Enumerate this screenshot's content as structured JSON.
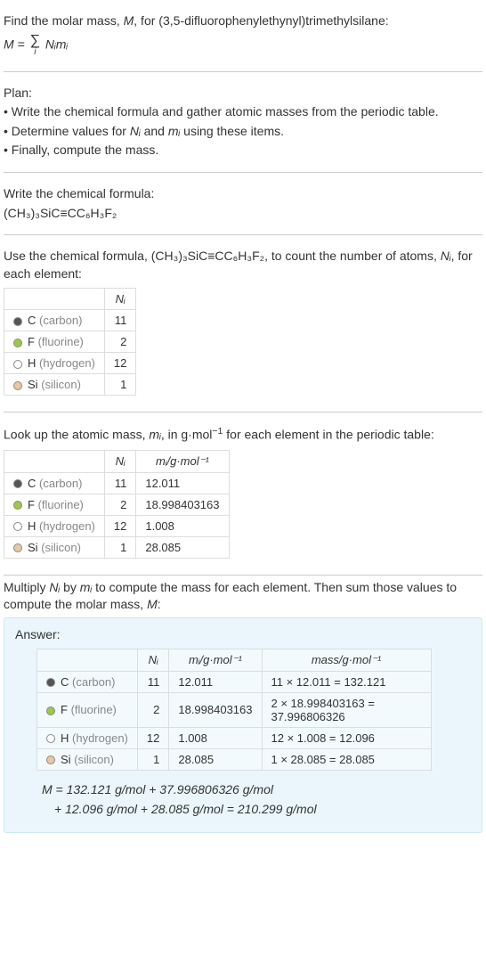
{
  "intro": {
    "line1_pre": "Find the molar mass, ",
    "line1_m": "M",
    "line1_post": ", for (3,5-difluorophenylethynyl)trimethylsilane:",
    "formula_lhs": "M = ",
    "formula_rhs": " Nᵢmᵢ",
    "sigma_sub": "i"
  },
  "plan": {
    "title": "Plan:",
    "b1": "• Write the chemical formula and gather atomic masses from the periodic table.",
    "b2_pre": "• Determine values for ",
    "b2_ni": "Nᵢ",
    "b2_mid": " and ",
    "b2_mi": "mᵢ",
    "b2_post": " using these items.",
    "b3": "• Finally, compute the mass."
  },
  "chem": {
    "title": "Write the chemical formula:",
    "formula": "(CH₃)₃SiC≡CC₆H₃F₂"
  },
  "count": {
    "line_pre": "Use the chemical formula, (CH₃)₃SiC≡CC₆H₃F₂, to count the number of atoms, ",
    "ni": "Nᵢ",
    "line_post": ", for each element:"
  },
  "table1": {
    "h_ni": "Nᵢ",
    "rows": [
      {
        "dot": "dot-c",
        "sym": "C",
        "name": "(carbon)",
        "ni": "11"
      },
      {
        "dot": "dot-f",
        "sym": "F",
        "name": "(fluorine)",
        "ni": "2"
      },
      {
        "dot": "dot-h",
        "sym": "H",
        "name": "(hydrogen)",
        "ni": "12"
      },
      {
        "dot": "dot-si",
        "sym": "Si",
        "name": "(silicon)",
        "ni": "1"
      }
    ]
  },
  "lookup": {
    "line_pre": "Look up the atomic mass, ",
    "mi": "mᵢ",
    "line_mid": ", in g·mol",
    "exp": "−1",
    "line_post": " for each element in the periodic table:"
  },
  "table2": {
    "h_ni": "Nᵢ",
    "h_mi": "mᵢ/g·mol⁻¹",
    "rows": [
      {
        "dot": "dot-c",
        "sym": "C",
        "name": "(carbon)",
        "ni": "11",
        "mi": "12.011"
      },
      {
        "dot": "dot-f",
        "sym": "F",
        "name": "(fluorine)",
        "ni": "2",
        "mi": "18.998403163"
      },
      {
        "dot": "dot-h",
        "sym": "H",
        "name": "(hydrogen)",
        "ni": "12",
        "mi": "1.008"
      },
      {
        "dot": "dot-si",
        "sym": "Si",
        "name": "(silicon)",
        "ni": "1",
        "mi": "28.085"
      }
    ]
  },
  "multiply": {
    "text_pre": "Multiply ",
    "ni": "Nᵢ",
    "text_mid1": " by ",
    "mi": "mᵢ",
    "text_mid2": " to compute the mass for each element. Then sum those values to compute the molar mass, ",
    "m": "M",
    "text_post": ":"
  },
  "answer": {
    "label": "Answer:",
    "h_ni": "Nᵢ",
    "h_mi": "mᵢ/g·mol⁻¹",
    "h_mass": "mass/g·mol⁻¹",
    "rows": [
      {
        "dot": "dot-c",
        "sym": "C",
        "name": "(carbon)",
        "ni": "11",
        "mi": "12.011",
        "mass": "11 × 12.011 = 132.121"
      },
      {
        "dot": "dot-f",
        "sym": "F",
        "name": "(fluorine)",
        "ni": "2",
        "mi": "18.998403163",
        "mass": "2 × 18.998403163 = 37.996806326"
      },
      {
        "dot": "dot-h",
        "sym": "H",
        "name": "(hydrogen)",
        "ni": "12",
        "mi": "1.008",
        "mass": "12 × 1.008 = 12.096"
      },
      {
        "dot": "dot-si",
        "sym": "Si",
        "name": "(silicon)",
        "ni": "1",
        "mi": "28.085",
        "mass": "1 × 28.085 = 28.085"
      }
    ],
    "final_line1": "M = 132.121 g/mol + 37.996806326 g/mol",
    "final_line2": "+ 12.096 g/mol + 28.085 g/mol = 210.299 g/mol"
  },
  "chart_data": {
    "type": "table",
    "title": "Molar mass computation for (3,5-difluorophenylethynyl)trimethylsilane",
    "elements": [
      {
        "symbol": "C",
        "name": "carbon",
        "count": 11,
        "atomic_mass": 12.011,
        "mass_contrib": 132.121
      },
      {
        "symbol": "F",
        "name": "fluorine",
        "count": 2,
        "atomic_mass": 18.998403163,
        "mass_contrib": 37.996806326
      },
      {
        "symbol": "H",
        "name": "hydrogen",
        "count": 12,
        "atomic_mass": 1.008,
        "mass_contrib": 12.096
      },
      {
        "symbol": "Si",
        "name": "silicon",
        "count": 1,
        "atomic_mass": 28.085,
        "mass_contrib": 28.085
      }
    ],
    "molar_mass_g_per_mol": 210.299
  }
}
